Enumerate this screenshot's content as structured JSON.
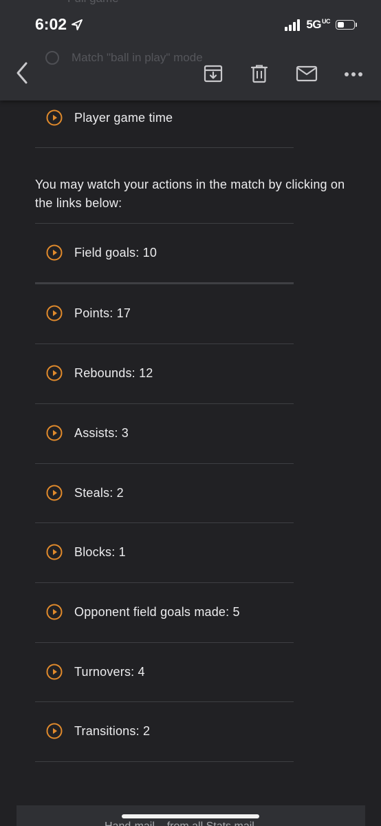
{
  "status_bar": {
    "time": "6:02",
    "network": "5G",
    "network_suffix": "UC"
  },
  "header": {
    "ghost_top_text": "Full game",
    "ghost_row_text": "Match \"ball in play\" mode"
  },
  "email": {
    "top_item": "Player game time",
    "intro": "You may watch your actions in the match by clicking on the links below:",
    "links": [
      "Field goals: 10",
      "Points: 17",
      "Rebounds: 12",
      "Assists: 3",
      "Steals: 2",
      "Blocks: 1",
      "Opponent field goals made: 5",
      "Turnovers: 4",
      "Transitions: 2"
    ],
    "footer_partial": "Hand-mail... from all Stats mail"
  },
  "colors": {
    "accent": "#e08a2c",
    "background": "#212124",
    "header": "#2e2f33"
  },
  "icons": {
    "back": "chevron-left-icon",
    "archive": "archive-icon",
    "delete": "trash-icon",
    "mail": "mail-icon",
    "more": "more-horizontal-icon",
    "play": "play-circle-icon"
  }
}
